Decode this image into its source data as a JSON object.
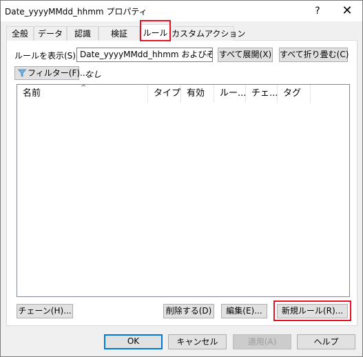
{
  "window": {
    "title": "Date_yyyyMMdd_hhmm プロパティ",
    "help_label": "?",
    "close_label": "✕"
  },
  "tabs": [
    {
      "label": "全般"
    },
    {
      "label": "データ"
    },
    {
      "label": "認識"
    },
    {
      "label": "検証"
    },
    {
      "label": "ルール"
    },
    {
      "label": "カスタムアクション"
    }
  ],
  "rules": {
    "show_label": "ルールを表示(S):",
    "show_value": "Date_yyyyMMdd_hhmm およびその子",
    "expand_all_label": "すべて展開(X)",
    "collapse_all_label": "すべて折り畳む(C)",
    "filter_label": "フィルター(F)...",
    "filter_value": "なし",
    "columns": [
      {
        "label": "名前"
      },
      {
        "label": "タイプ"
      },
      {
        "label": "有効"
      },
      {
        "label": "ルー..."
      },
      {
        "label": "チェ..."
      },
      {
        "label": "タグ"
      }
    ],
    "chain_label": "チェーン(H)...",
    "delete_label": "削除する(D)",
    "edit_label": "編集(E)...",
    "new_rule_label": "新規ルール(R)..."
  },
  "footer": {
    "ok_label": "OK",
    "cancel_label": "キャンセル",
    "apply_label": "適用(A)",
    "help_label": "ヘルプ"
  },
  "colors": {
    "highlight": "#e81123",
    "focus": "#0078d7"
  }
}
